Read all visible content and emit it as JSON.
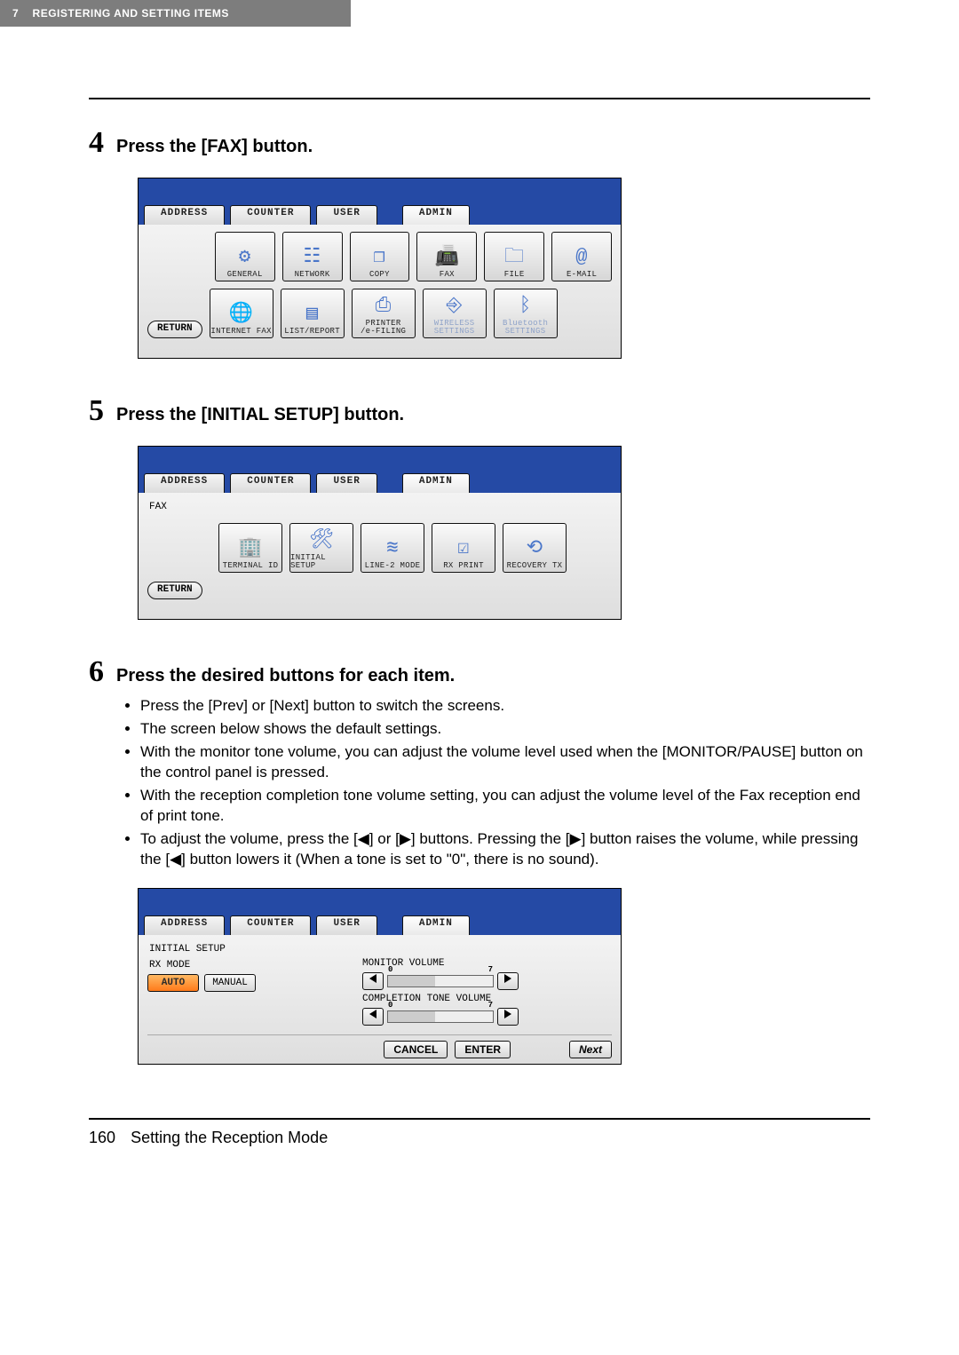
{
  "header": {
    "chapter_num": "7",
    "chapter_title": "REGISTERING AND SETTING ITEMS"
  },
  "steps": [
    {
      "num": "4",
      "title": "Press the [FAX] button."
    },
    {
      "num": "5",
      "title": "Press the [INITIAL SETUP] button."
    },
    {
      "num": "6",
      "title": "Press the desired buttons for each item."
    }
  ],
  "tabs_common": {
    "address": "ADDRESS",
    "counter": "COUNTER",
    "user": "USER",
    "admin": "ADMIN"
  },
  "screen1": {
    "icons_row1": [
      {
        "label": "GENERAL",
        "name": "general-icon-button"
      },
      {
        "label": "NETWORK",
        "name": "network-icon-button"
      },
      {
        "label": "COPY",
        "name": "copy-icon-button"
      },
      {
        "label": "FAX",
        "name": "fax-icon-button"
      },
      {
        "label": "FILE",
        "name": "file-icon-button"
      },
      {
        "label": "E-MAIL",
        "name": "email-icon-button"
      }
    ],
    "icons_row2": [
      {
        "label": "INTERNET FAX",
        "name": "internet-fax-icon-button"
      },
      {
        "label": "LIST/REPORT",
        "name": "list-report-icon-button"
      },
      {
        "label": "PRINTER\n/e-FILING",
        "name": "printer-efiling-icon-button"
      },
      {
        "label": "WIRELESS\nSETTINGS",
        "name": "wireless-settings-icon-button",
        "disabled": true
      },
      {
        "label": "Bluetooth\nSETTINGS",
        "name": "bluetooth-settings-icon-button",
        "disabled": true
      }
    ],
    "return": "RETURN"
  },
  "screen2": {
    "crumb": "FAX",
    "icons": [
      {
        "label": "TERMINAL ID",
        "name": "terminal-id-icon-button"
      },
      {
        "label": "INITIAL SETUP",
        "name": "initial-setup-icon-button"
      },
      {
        "label": "LINE-2 MODE",
        "name": "line2-mode-icon-button"
      },
      {
        "label": "RX PRINT",
        "name": "rx-print-icon-button"
      },
      {
        "label": "RECOVERY TX",
        "name": "recovery-tx-icon-button"
      }
    ],
    "return": "RETURN"
  },
  "step6_bullets": [
    "Press the [Prev] or [Next] button to switch the screens.",
    "The screen below shows the default settings.",
    "With the monitor tone volume, you can adjust the volume level used when the [MONITOR/PAUSE] button on the control panel is pressed.",
    "With the reception completion tone volume setting, you can adjust the volume level of the Fax reception end of print tone.",
    "To adjust the volume, press the [◀] or [▶] buttons. Pressing the [▶] button raises the volume, while pressing the [◀] button lowers it (When a tone is set to \"0\", there is no sound)."
  ],
  "screen3": {
    "crumb": "INITIAL SETUP",
    "rx_mode_label": "RX MODE",
    "auto": "AUTO",
    "manual": "MANUAL",
    "monitor_volume_label": "MONITOR VOLUME",
    "completion_tone_label": "COMPLETION TONE VOLUME",
    "cancel": "CANCEL",
    "enter": "ENTER",
    "next": "Next"
  },
  "footer": {
    "page": "160",
    "title": "Setting the Reception Mode"
  }
}
